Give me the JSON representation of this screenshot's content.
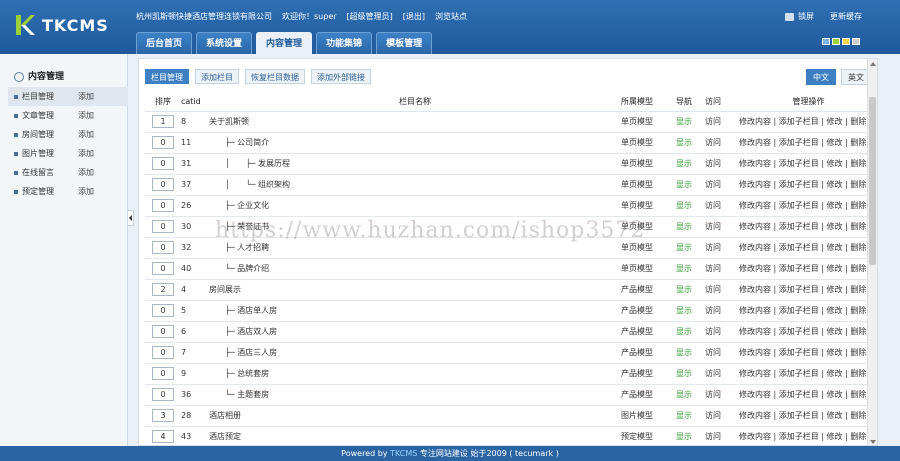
{
  "header": {
    "logo_text": "TKCMS",
    "company": "杭州凯斯顿快捷酒店管理连锁有限公司",
    "welcome": "欢迎你！super",
    "role": "[超级管理员]",
    "logout": "[退出]",
    "browse": "浏览站点",
    "lock": "锁屏",
    "cache": "更新缓存",
    "skin_colors": [
      "#7fb3e6",
      "#9bd23a",
      "#f1d44a",
      "#d0d0d0"
    ]
  },
  "tabs": [
    {
      "label": "后台首页",
      "active": false
    },
    {
      "label": "系统设置",
      "active": false
    },
    {
      "label": "内容管理",
      "active": true
    },
    {
      "label": "功能集锦",
      "active": false
    },
    {
      "label": "模板管理",
      "active": false
    }
  ],
  "sidebar": {
    "title": "内容管理",
    "items": [
      {
        "label": "栏目管理",
        "add": "添加",
        "active": true
      },
      {
        "label": "文章管理",
        "add": "添加",
        "active": false
      },
      {
        "label": "房间管理",
        "add": "添加",
        "active": false
      },
      {
        "label": "图片管理",
        "add": "添加",
        "active": false
      },
      {
        "label": "在线留言",
        "add": "添加",
        "active": false
      },
      {
        "label": "预定管理",
        "add": "添加",
        "active": false
      }
    ]
  },
  "toolbar": {
    "buttons": [
      "栏目管理",
      "添加栏目",
      "恢复栏目数据",
      "添加外部链接"
    ],
    "langs": [
      "中文",
      "英文"
    ]
  },
  "table": {
    "headers": [
      "排序",
      "catid",
      "栏目名称",
      "所属模型",
      "导航",
      "访问",
      "管理操作"
    ],
    "show_label": "显示",
    "visit_label": "访问",
    "ops": "修改内容 | 添加子栏目 | 修改 | 删除",
    "rows": [
      {
        "sort": "1",
        "catid": "8",
        "name": "关于凯斯顿",
        "model": "单页模型"
      },
      {
        "sort": "0",
        "catid": "11",
        "name": "　　├─ 公司简介",
        "model": "单页模型"
      },
      {
        "sort": "0",
        "catid": "31",
        "name": "　　│　　├─ 发展历程",
        "model": "单页模型"
      },
      {
        "sort": "0",
        "catid": "37",
        "name": "　　│　　└─ 组织架构",
        "model": "单页模型"
      },
      {
        "sort": "0",
        "catid": "26",
        "name": "　　├─ 企业文化",
        "model": "单页模型"
      },
      {
        "sort": "0",
        "catid": "30",
        "name": "　　├─ 荣誉证书",
        "model": "单页模型"
      },
      {
        "sort": "0",
        "catid": "32",
        "name": "　　├─ 人才招聘",
        "model": "单页模型"
      },
      {
        "sort": "0",
        "catid": "40",
        "name": "　　└─ 品牌介绍",
        "model": "单页模型"
      },
      {
        "sort": "2",
        "catid": "4",
        "name": "房间展示",
        "model": "产品模型"
      },
      {
        "sort": "0",
        "catid": "5",
        "name": "　　├─ 酒店单人房",
        "model": "产品模型"
      },
      {
        "sort": "0",
        "catid": "6",
        "name": "　　├─ 酒店双人房",
        "model": "产品模型"
      },
      {
        "sort": "0",
        "catid": "7",
        "name": "　　├─ 酒店三人房",
        "model": "产品模型"
      },
      {
        "sort": "0",
        "catid": "9",
        "name": "　　├─ 总统套房",
        "model": "产品模型"
      },
      {
        "sort": "0",
        "catid": "36",
        "name": "　　└─ 主题套房",
        "model": "产品模型"
      },
      {
        "sort": "3",
        "catid": "28",
        "name": "酒店相册",
        "model": "图片模型"
      },
      {
        "sort": "4",
        "catid": "43",
        "name": "酒店预定",
        "model": "预定模型"
      }
    ]
  },
  "footer": {
    "prefix": "Powered by ",
    "brand": "TKCMS",
    "suffix": " 专注网站建设  始于2009 ( tecumark )"
  },
  "watermark": "https://www.huzhan.com/ishop3572"
}
